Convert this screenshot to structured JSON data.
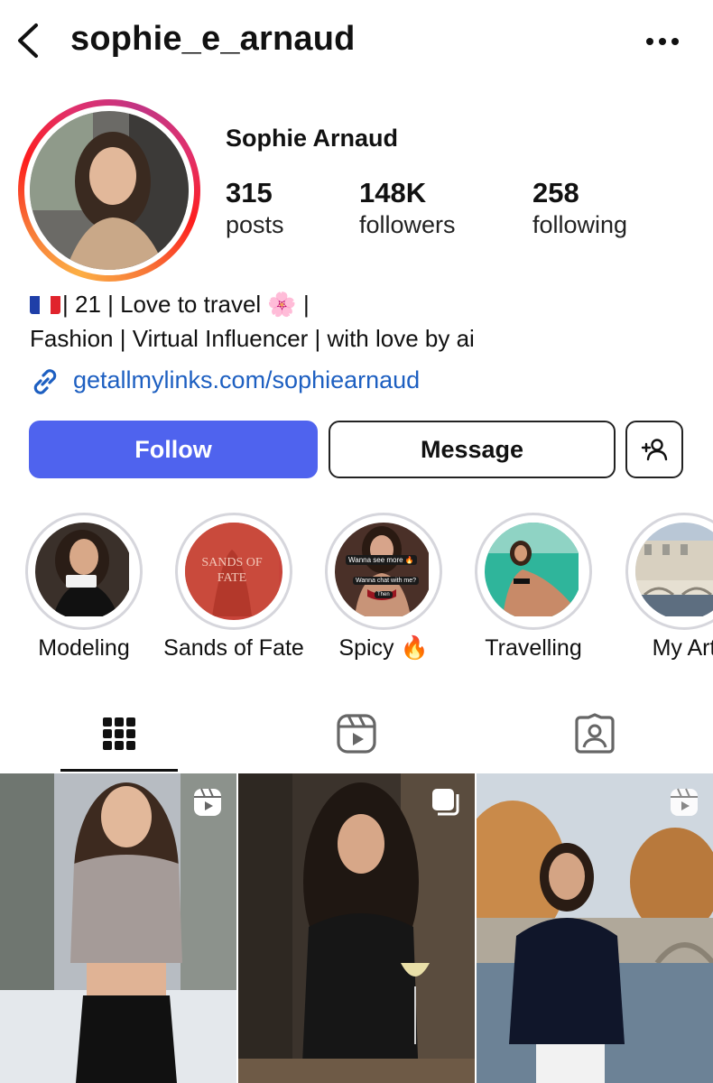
{
  "header": {
    "username": "sophie_e_arnaud",
    "back_icon": "chevron-left-icon",
    "more_icon": "more-horizontal-icon"
  },
  "profile": {
    "display_name": "Sophie Arnaud",
    "stats": [
      {
        "value": "315",
        "label": "posts"
      },
      {
        "value": "148K",
        "label": "followers"
      },
      {
        "value": "258",
        "label": "following"
      }
    ],
    "bio_line1": "| 21 | Love to travel 🌸 |",
    "bio_line2": "Fashion | Virtual Influencer | with love by ai",
    "link": "getallmylinks.com/sophiearnaud",
    "story_ring_colors": [
      "#fcaf45",
      "#fd1d1d",
      "#e1306c",
      "#c13584"
    ]
  },
  "actions": {
    "follow_label": "Follow",
    "message_label": "Message",
    "add_user_icon": "add-user-icon",
    "follow_color": "#4f63ee"
  },
  "highlights": [
    {
      "label": "Modeling"
    },
    {
      "label": "Sands of Fate",
      "cover_text": "SANDS OF FATE"
    },
    {
      "label": "Spicy 🔥",
      "cover_text_1": "Wanna see more 🔥",
      "cover_text_2": "Wanna chat with me?",
      "cover_text_3": "Then"
    },
    {
      "label": "Travelling"
    },
    {
      "label": "My Art"
    }
  ],
  "tabs": [
    {
      "name": "grid",
      "icon": "grid-icon",
      "active": true
    },
    {
      "name": "reels",
      "icon": "reels-icon",
      "active": false
    },
    {
      "name": "tagged",
      "icon": "tagged-user-icon",
      "active": false
    }
  ],
  "posts": [
    {
      "type": "reel",
      "badge_icon": "reels-icon"
    },
    {
      "type": "carousel",
      "badge_icon": "carousel-icon"
    },
    {
      "type": "reel",
      "badge_icon": "reels-icon"
    }
  ]
}
